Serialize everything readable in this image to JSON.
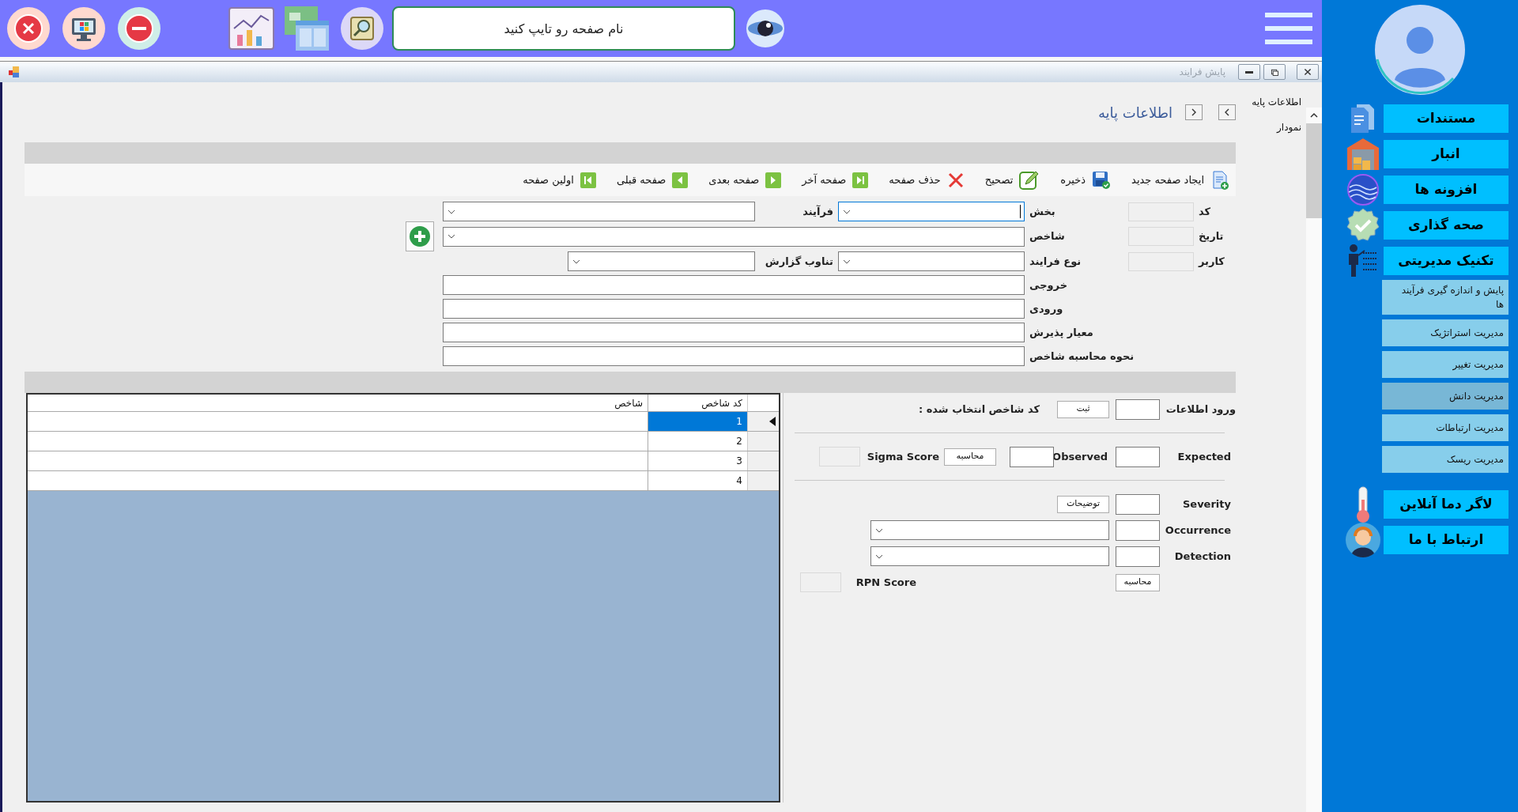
{
  "top_bar": {
    "search": {
      "placeholder": "نام صفحه رو تایپ کنید"
    }
  },
  "window": {
    "title": "پایش فرایند"
  },
  "side_nav": [
    {
      "label": "اطلاعات پایه"
    },
    {
      "label": "نمودار"
    }
  ],
  "page_title": "اطلاعات پایه",
  "toolbar": [
    {
      "label": "ایجاد صفحه جدید"
    },
    {
      "label": "ذخیره"
    },
    {
      "label": "تصحیح"
    },
    {
      "label": "حذف صفحه"
    },
    {
      "label": "صفحه آخر"
    },
    {
      "label": "صفحه بعدی"
    },
    {
      "label": "صفحه قبلی"
    },
    {
      "label": "اولین صفحه"
    }
  ],
  "form": {
    "side_fields": [
      {
        "label": "کد"
      },
      {
        "label": "تاریخ"
      },
      {
        "label": "کاربر"
      }
    ],
    "rows": [
      {
        "fields": [
          {
            "label": "بخش",
            "kind": "combo",
            "focused": true
          },
          {
            "label": "فرآیند",
            "kind": "combo",
            "focused": false
          }
        ]
      },
      {
        "fields": [
          {
            "label": "شاخص",
            "kind": "combo",
            "focused": false
          }
        ]
      },
      {
        "fields": [
          {
            "label": "نوع فرایند",
            "kind": "combo",
            "focused": false
          },
          {
            "label": "تناوب گزارش",
            "kind": "combo",
            "focused": false
          }
        ]
      },
      {
        "fields": [
          {
            "label": "خروجی",
            "kind": "text",
            "focused": false
          }
        ]
      },
      {
        "fields": [
          {
            "label": "ورودی",
            "kind": "text",
            "focused": false
          }
        ]
      },
      {
        "fields": [
          {
            "label": "معیار پذیرش",
            "kind": "text",
            "focused": false
          }
        ]
      },
      {
        "fields": [
          {
            "label": "نحوه محاسبه شاخص",
            "kind": "text",
            "focused": false
          }
        ]
      }
    ]
  },
  "table": {
    "columns": [
      "کد شاخص",
      "شاخص"
    ],
    "rows": [
      {
        "code": "1",
        "selected": true
      },
      {
        "code": "2",
        "selected": false
      },
      {
        "code": "3",
        "selected": false
      },
      {
        "code": "4",
        "selected": false
      }
    ]
  },
  "data_entry": {
    "label": "ورود اطلاعات",
    "submit_button": "ثبت",
    "selected_code_label": "کد شاخص انتخاب شده :"
  },
  "sigma": {
    "expected_label": "Expected",
    "observed_label": "Observed",
    "calc_button": "محاسبه",
    "score_label": "Sigma Score"
  },
  "fmea": {
    "severity_label": "Severity",
    "notes_button": "توضیحات",
    "occurrence_label": "Occurrence",
    "detection_label": "Detection",
    "calc_button": "محاسبه",
    "score_label": "RPN Score"
  },
  "sidebar": {
    "items": [
      {
        "label": "مستندات",
        "kind": "main"
      },
      {
        "label": "انبار",
        "kind": "main"
      },
      {
        "label": "افزونه ها",
        "kind": "main"
      },
      {
        "label": "صحه گذاری",
        "kind": "main"
      },
      {
        "label": "تکنیک مدیریتی",
        "kind": "main"
      },
      {
        "label": "پایش و اندازه گیری فرآیند ها",
        "kind": "sub",
        "selected": false
      },
      {
        "label": "مدیریت استراتژیک",
        "kind": "sub",
        "selected": false
      },
      {
        "label": "مدیریت تغییر",
        "kind": "sub",
        "selected": false
      },
      {
        "label": "مدیریت دانش",
        "kind": "sub",
        "selected": true
      },
      {
        "label": "مدیریت ارتباطات",
        "kind": "sub",
        "selected": false
      },
      {
        "label": "مدیریت ریسک",
        "kind": "sub",
        "selected": false
      },
      {
        "label": "لاگر دما آنلاین",
        "kind": "main"
      },
      {
        "label": "ارتباط با ما",
        "kind": "main"
      }
    ]
  }
}
